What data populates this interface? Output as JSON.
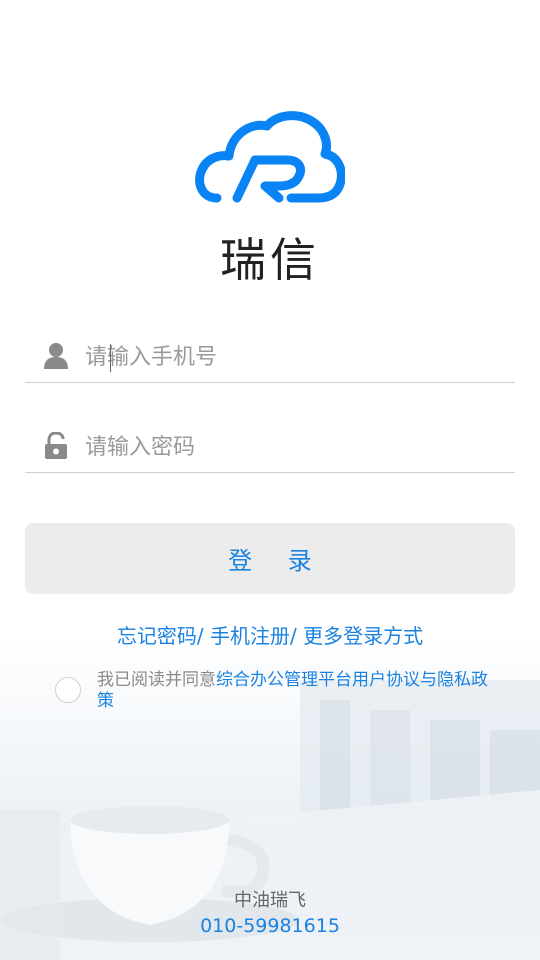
{
  "app": {
    "name": "瑞信",
    "brand_color": "#0a84f5"
  },
  "form": {
    "phone_placeholder": "请输入手机号",
    "phone_icon": "user-icon",
    "password_placeholder": "请输入密码",
    "password_icon": "unlock-icon",
    "login_label": "登 录"
  },
  "links": {
    "forgot_password": "忘记密码/",
    "register": "手机注册/",
    "more_login": "更多登录方式"
  },
  "agreement": {
    "checked": false,
    "prefix": "我已阅读并同意",
    "link_text": "综合办公管理平台用户协议与隐私政策"
  },
  "footer": {
    "company": "中油瑞飞",
    "phone": "010-59981615"
  },
  "colors": {
    "accent": "#1a82e0",
    "button_bg": "#ececec",
    "divider": "#cfcfcf"
  }
}
